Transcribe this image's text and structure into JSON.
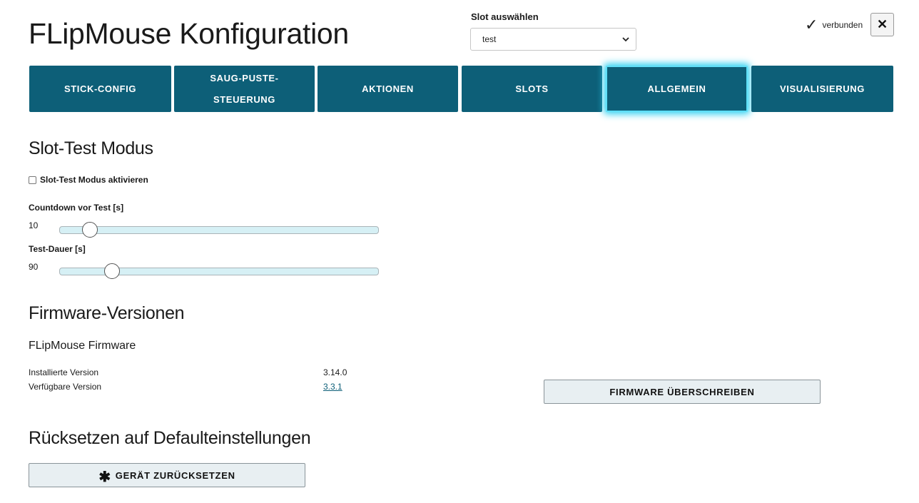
{
  "header": {
    "title": "FLipMouse Konfiguration",
    "slot_label": "Slot auswählen",
    "slot_selected": "test",
    "connection_status": "verbunden",
    "close_label": "✕"
  },
  "tabs": [
    {
      "label": "STICK-CONFIG"
    },
    {
      "label": "SAUG-PUSTE-STEUERUNG"
    },
    {
      "label": "AKTIONEN"
    },
    {
      "label": "SLOTS"
    },
    {
      "label": "ALLGEMEIN",
      "active": true
    },
    {
      "label": "VISUALISIERUNG"
    }
  ],
  "slot_test": {
    "heading": "Slot-Test Modus",
    "checkbox_label": "Slot-Test Modus aktivieren",
    "countdown": {
      "label": "Countdown vor Test [s]",
      "value": "10",
      "fraction": 0.096
    },
    "duration": {
      "label": "Test-Dauer [s]",
      "value": "90",
      "fraction": 0.165
    }
  },
  "firmware": {
    "heading": "Firmware-Versionen",
    "subheading": "FLipMouse Firmware",
    "installed_label": "Installierte Version",
    "installed_value": "3.14.0",
    "available_label": "Verfügbare Version",
    "available_value": "3.3.1",
    "overwrite_button": "FIRMWARE ÜBERSCHREIBEN"
  },
  "reset": {
    "heading": "Rücksetzen auf Defaulteinstellungen",
    "button_label": "GERÄT ZURÜCKSETZEN",
    "button_icon": "✱"
  },
  "colors": {
    "tab_bg": "#0d5f78",
    "tab_active_glow": "#2fd0f0",
    "slider_track": "#d6f0f5",
    "button_bg": "#e8eff2"
  }
}
